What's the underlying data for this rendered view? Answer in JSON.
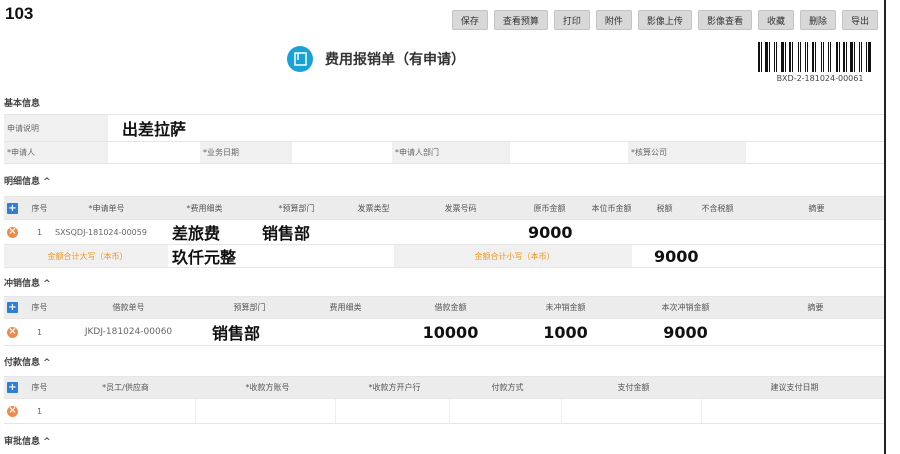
{
  "page_number": "103",
  "toolbar": {
    "save": "保存",
    "view_budget": "查看预算",
    "print": "打印",
    "attachment": "附件",
    "image_upload": "影像上传",
    "image_view": "影像查看",
    "favorite": "收藏",
    "delete": "删除",
    "export": "导出"
  },
  "title": "费用报销单（有申请）",
  "barcode_text": "BXD-2-181024-00061",
  "basic": {
    "section_title": "基本信息",
    "description_label": "申请说明",
    "description_value": "出差拉萨",
    "applicant_label": "*申请人",
    "business_date_label": "*业务日期",
    "dept_label": "*申请人部门",
    "company_label": "*核算公司"
  },
  "detail": {
    "section_title": "明细信息",
    "headers": [
      "序号",
      "*申请单号",
      "*费用细类",
      "*预算部门",
      "发票类型",
      "发票号码",
      "原币金额",
      "本位币金额",
      "税额",
      "不含税额",
      "摘要"
    ],
    "row": {
      "index": "1",
      "apply_no": "SXSQDJ-181024-00059",
      "expense_type": "差旅费",
      "budget_dept": "销售部",
      "amount": "9000"
    },
    "total_upper_label": "金额合计大写（本币）",
    "total_upper_value": "玖仟元整",
    "total_lower_label": "金额合计小写（本币）",
    "total_lower_value": "9000"
  },
  "offset": {
    "section_title": "冲销信息",
    "headers": [
      "序号",
      "借款单号",
      "预算部门",
      "费用细类",
      "借款金额",
      "未冲销金额",
      "本次冲销金额",
      "摘要"
    ],
    "row": {
      "index": "1",
      "loan_no": "JKDJ-181024-00060",
      "budget_dept": "销售部",
      "loan_amount": "10000",
      "unoffset_amount": "1000",
      "offset_amount": "9000"
    }
  },
  "payment": {
    "section_title": "付款信息",
    "headers": [
      "序号",
      "*员工/供应商",
      "*收款方账号",
      "*收款方开户行",
      "付款方式",
      "支付金额",
      "建议支付日期"
    ],
    "row": {
      "index": "1"
    }
  },
  "approval": {
    "section_title": "审批信息"
  },
  "colors": {
    "accent": "#1aa2d6",
    "plus": "#2b7fd6",
    "minus": "#f08a4b",
    "orange_label": "#f0961e"
  }
}
